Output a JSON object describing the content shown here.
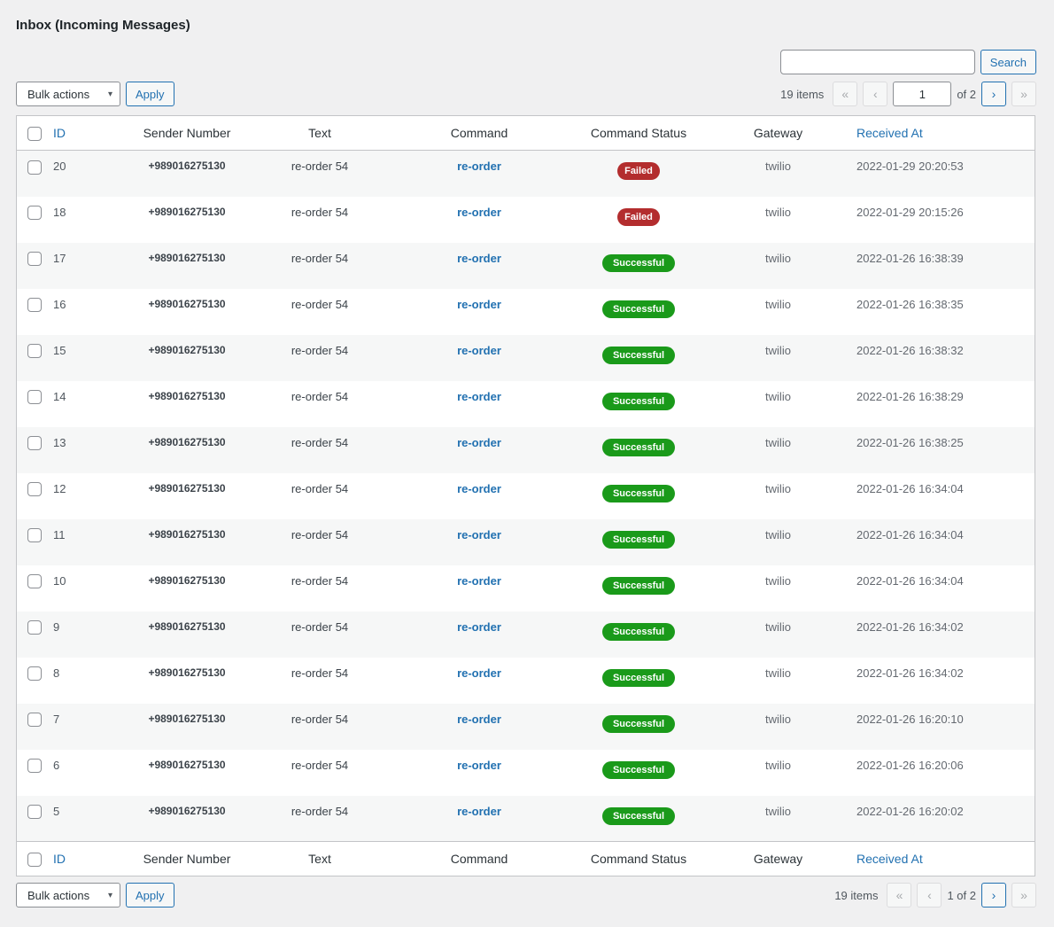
{
  "page": {
    "title": "Inbox (Incoming Messages)"
  },
  "search": {
    "placeholder": "",
    "button_label": "Search"
  },
  "colors": {
    "accent": "#2271b1",
    "failed": "#b32d2e",
    "successful": "#1a9a1a"
  },
  "bulk": {
    "label": "Bulk actions",
    "apply_label": "Apply"
  },
  "pagination_top": {
    "items_text": "19 items",
    "current_page": "1",
    "of_text": "of 2",
    "first": "«",
    "prev": "‹",
    "next": "›",
    "last": "»"
  },
  "pagination_bottom": {
    "items_text": "19 items",
    "page_text": "1 of 2",
    "first": "«",
    "prev": "‹",
    "next": "›",
    "last": "»"
  },
  "columns": {
    "id": "ID",
    "sender": "Sender Number",
    "text": "Text",
    "command": "Command",
    "status": "Command Status",
    "gateway": "Gateway",
    "received": "Received At"
  },
  "rows": [
    {
      "id": "20",
      "sender": "+989016275130",
      "text": "re-order 54",
      "command": "re-order",
      "status": "Failed",
      "gateway": "twilio",
      "received": "2022-01-29 20:20:53"
    },
    {
      "id": "18",
      "sender": "+989016275130",
      "text": "re-order 54",
      "command": "re-order",
      "status": "Failed",
      "gateway": "twilio",
      "received": "2022-01-29 20:15:26"
    },
    {
      "id": "17",
      "sender": "+989016275130",
      "text": "re-order 54",
      "command": "re-order",
      "status": "Successful",
      "gateway": "twilio",
      "received": "2022-01-26 16:38:39"
    },
    {
      "id": "16",
      "sender": "+989016275130",
      "text": "re-order 54",
      "command": "re-order",
      "status": "Successful",
      "gateway": "twilio",
      "received": "2022-01-26 16:38:35"
    },
    {
      "id": "15",
      "sender": "+989016275130",
      "text": "re-order 54",
      "command": "re-order",
      "status": "Successful",
      "gateway": "twilio",
      "received": "2022-01-26 16:38:32"
    },
    {
      "id": "14",
      "sender": "+989016275130",
      "text": "re-order 54",
      "command": "re-order",
      "status": "Successful",
      "gateway": "twilio",
      "received": "2022-01-26 16:38:29"
    },
    {
      "id": "13",
      "sender": "+989016275130",
      "text": "re-order 54",
      "command": "re-order",
      "status": "Successful",
      "gateway": "twilio",
      "received": "2022-01-26 16:38:25"
    },
    {
      "id": "12",
      "sender": "+989016275130",
      "text": "re-order 54",
      "command": "re-order",
      "status": "Successful",
      "gateway": "twilio",
      "received": "2022-01-26 16:34:04"
    },
    {
      "id": "11",
      "sender": "+989016275130",
      "text": "re-order 54",
      "command": "re-order",
      "status": "Successful",
      "gateway": "twilio",
      "received": "2022-01-26 16:34:04"
    },
    {
      "id": "10",
      "sender": "+989016275130",
      "text": "re-order 54",
      "command": "re-order",
      "status": "Successful",
      "gateway": "twilio",
      "received": "2022-01-26 16:34:04"
    },
    {
      "id": "9",
      "sender": "+989016275130",
      "text": "re-order 54",
      "command": "re-order",
      "status": "Successful",
      "gateway": "twilio",
      "received": "2022-01-26 16:34:02"
    },
    {
      "id": "8",
      "sender": "+989016275130",
      "text": "re-order 54",
      "command": "re-order",
      "status": "Successful",
      "gateway": "twilio",
      "received": "2022-01-26 16:34:02"
    },
    {
      "id": "7",
      "sender": "+989016275130",
      "text": "re-order 54",
      "command": "re-order",
      "status": "Successful",
      "gateway": "twilio",
      "received": "2022-01-26 16:20:10"
    },
    {
      "id": "6",
      "sender": "+989016275130",
      "text": "re-order 54",
      "command": "re-order",
      "status": "Successful",
      "gateway": "twilio",
      "received": "2022-01-26 16:20:06"
    },
    {
      "id": "5",
      "sender": "+989016275130",
      "text": "re-order 54",
      "command": "re-order",
      "status": "Successful",
      "gateway": "twilio",
      "received": "2022-01-26 16:20:02"
    }
  ]
}
